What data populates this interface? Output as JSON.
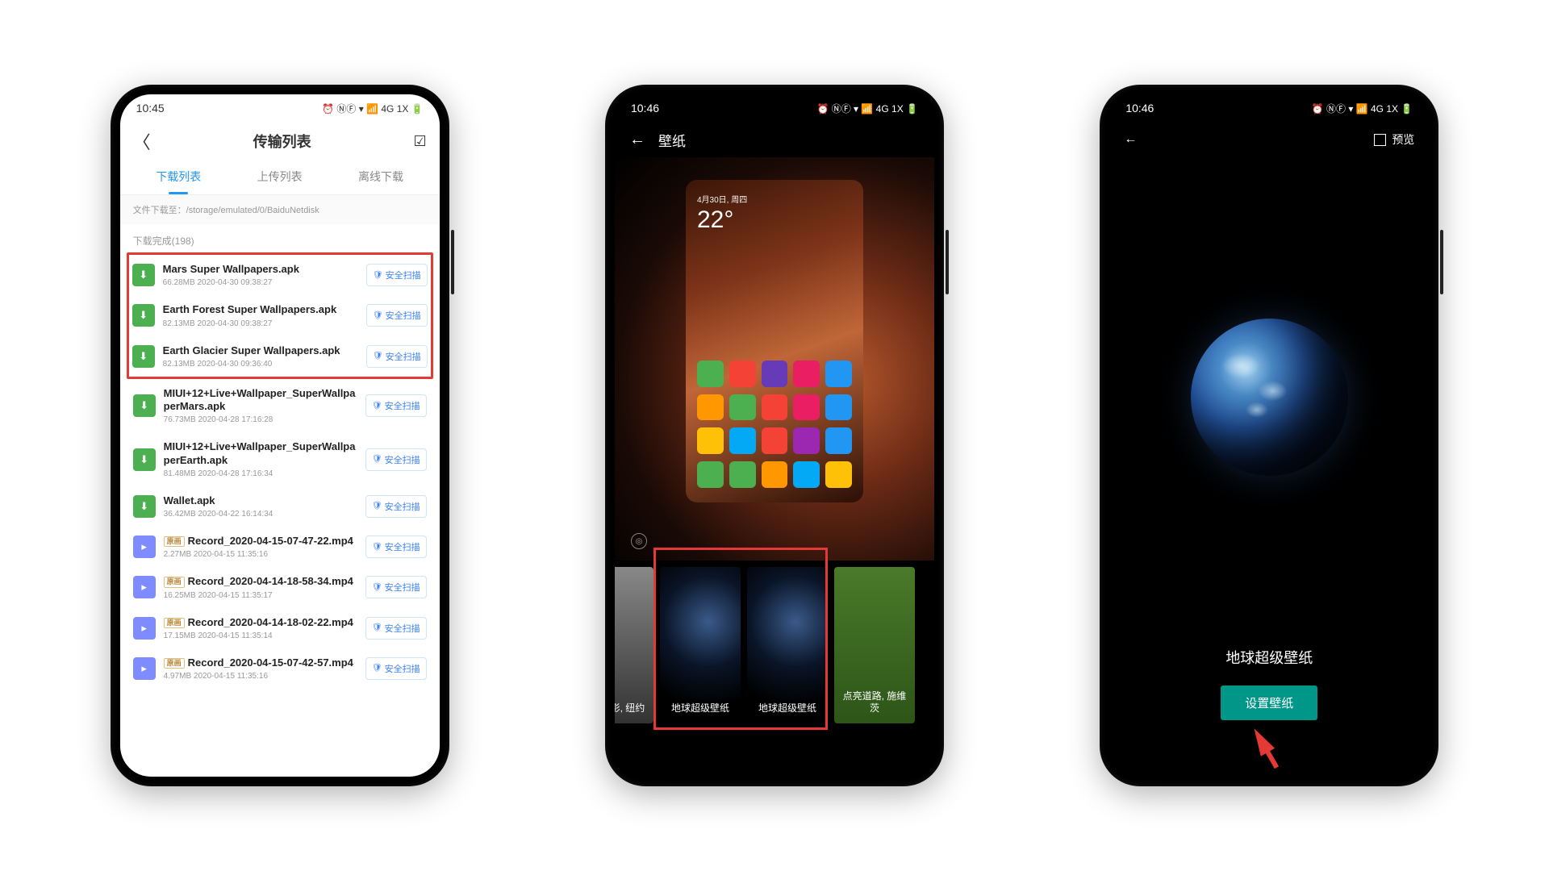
{
  "phone1": {
    "status_time": "10:45",
    "status_icons": "⏰ ⓃⒻ ▾ 📶 4G 1X 🔋",
    "title": "传输列表",
    "tabs": {
      "t0": "下载列表",
      "t1": "上传列表",
      "t2": "离线下载"
    },
    "path_line": "文件下载至：/storage/emulated/0/BaiduNetdisk",
    "section": "下载完成(198)",
    "scan_label": "安全扫描",
    "origin_badge": "原画",
    "files": [
      {
        "name": "Mars Super Wallpapers.apk",
        "meta": "66.28MB 2020-04-30 09:38:27",
        "icon": "apk",
        "badge": false
      },
      {
        "name": "Earth Forest Super Wallpapers.apk",
        "meta": "82.13MB 2020-04-30 09:38:27",
        "icon": "apk",
        "badge": false
      },
      {
        "name": "Earth Glacier Super Wallpapers.apk",
        "meta": "82.13MB 2020-04-30 09:36:40",
        "icon": "apk",
        "badge": false
      },
      {
        "name": "MIUI+12+Live+Wallpaper_SuperWallpaperMars.apk",
        "meta": "76.73MB 2020-04-28 17:16:28",
        "icon": "apk",
        "badge": false
      },
      {
        "name": "MIUI+12+Live+Wallpaper_SuperWallpaperEarth.apk",
        "meta": "81.48MB 2020-04-28 17:16:34",
        "icon": "apk",
        "badge": false
      },
      {
        "name": "Wallet.apk",
        "meta": "36.42MB 2020-04-22 16:14:34",
        "icon": "apk",
        "badge": false
      },
      {
        "name": "Record_2020-04-15-07-47-22.mp4",
        "meta": "2.27MB 2020-04-15 11:35:16",
        "icon": "video",
        "badge": true
      },
      {
        "name": "Record_2020-04-14-18-58-34.mp4",
        "meta": "16.25MB 2020-04-15 11:35:17",
        "icon": "video",
        "badge": true
      },
      {
        "name": "Record_2020-04-14-18-02-22.mp4",
        "meta": "17.15MB 2020-04-15 11:35:14",
        "icon": "video",
        "badge": true
      },
      {
        "name": "Record_2020-04-15-07-42-57.mp4",
        "meta": "4.97MB 2020-04-15 11:35:16",
        "icon": "video",
        "badge": true
      }
    ]
  },
  "phone2": {
    "status_time": "10:46",
    "status_icons": "⏰ ⓃⒻ ▾ 📶 4G 1X 🔋",
    "title": "壁纸",
    "hs_date": "4月30日, 周四",
    "hs_temp": "22°",
    "thumbs": {
      "t0": "城市剪影, 纽约",
      "t1": "地球超级壁纸",
      "t2": "地球超级壁纸",
      "t3": "点亮道路, 施维茨"
    }
  },
  "phone3": {
    "status_time": "10:46",
    "status_icons": "⏰ ⓃⒻ ▾ 📶 4G 1X 🔋",
    "preview_label": "预览",
    "wp_title": "地球超级壁纸",
    "set_btn": "设置壁纸"
  }
}
